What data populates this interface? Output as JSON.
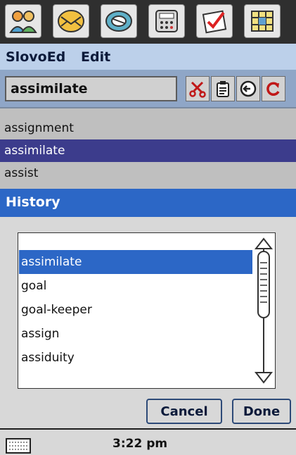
{
  "launcher": {
    "icons": [
      "people-icon",
      "mail-icon",
      "disc-icon",
      "calculator-icon",
      "tasks-icon",
      "grid-icon"
    ]
  },
  "menubar": {
    "items": [
      "SlovoEd",
      "Edit"
    ]
  },
  "search": {
    "value": "assimilate",
    "tools": [
      "cut-icon",
      "clipboard-icon",
      "back-arrow-icon",
      "refresh-icon"
    ]
  },
  "wordlist": {
    "items": [
      "assignment",
      "assimilate",
      "assist"
    ],
    "selected_index": 1
  },
  "history": {
    "title": "History",
    "items": [
      "assimilate",
      "goal",
      "goal-keeper",
      "assign",
      "assiduity"
    ],
    "selected_index": 0
  },
  "buttons": {
    "cancel": "Cancel",
    "done": "Done"
  },
  "status": {
    "time": "3:22 pm"
  },
  "colors": {
    "titlebar": "#2c67c6",
    "selection_list": "#3c3c8c",
    "menubar": "#bcd0ea"
  }
}
